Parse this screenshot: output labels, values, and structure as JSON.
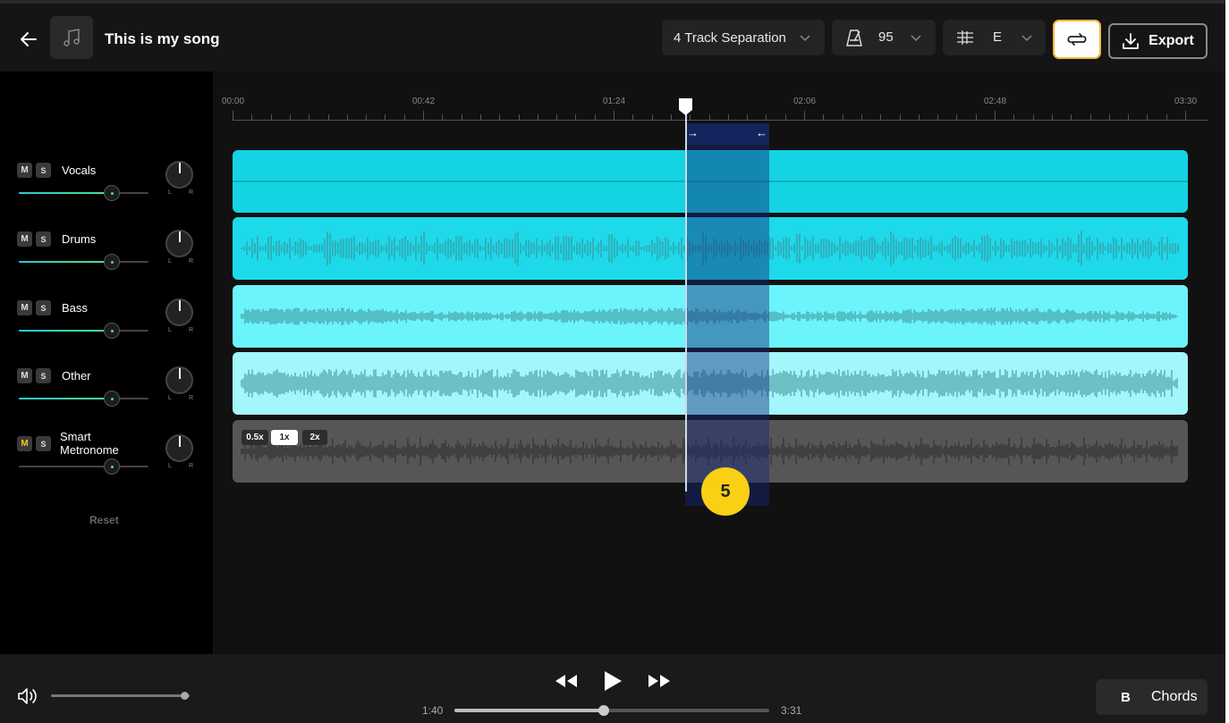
{
  "header": {
    "song_title": "This is my song",
    "separation": "4 Track Separation",
    "tempo": "95",
    "key": "E",
    "export_label": "Export"
  },
  "tracks": [
    {
      "name": "Vocals",
      "mute": "M",
      "solo": "S",
      "volume": 0.72,
      "lane_color": "#14d3e2",
      "wave": "flat"
    },
    {
      "name": "Drums",
      "mute": "M",
      "solo": "S",
      "volume": 0.72,
      "lane_color": "#1ed9ea",
      "wave": "drums"
    },
    {
      "name": "Bass",
      "mute": "M",
      "solo": "S",
      "volume": 0.72,
      "lane_color": "#6cf4fb",
      "wave": "bass"
    },
    {
      "name": "Other",
      "mute": "M",
      "solo": "S",
      "volume": 0.72,
      "lane_color": "#a3f6fc",
      "wave": "other"
    },
    {
      "name": "Smart\nMetronome",
      "mute": "M",
      "solo": "S",
      "volume": 0.72,
      "lane_color": "#565656",
      "wave": "metro",
      "mute_active": true
    }
  ],
  "pan_labels": {
    "left": "L",
    "right": "R"
  },
  "reset_label": "Reset",
  "ruler": [
    "00:00",
    "00:42",
    "01:24",
    "02:06",
    "02:48",
    "03:30"
  ],
  "metronome_speeds": [
    {
      "label": "0.5x",
      "active": false
    },
    {
      "label": "1x",
      "active": true
    },
    {
      "label": "2x",
      "active": false
    }
  ],
  "count_in": "5",
  "loop": {
    "start_arrow": "→",
    "end_arrow": "←"
  },
  "transport": {
    "current_time": "1:40",
    "total_time": "3:31",
    "progress": 0.474,
    "master_volume": 0.97
  },
  "chords": {
    "key": "B",
    "label": "Chords"
  },
  "colors": {
    "accent": "#f5b73d",
    "badge": "#f9d014",
    "slider": "#4ee08a"
  }
}
